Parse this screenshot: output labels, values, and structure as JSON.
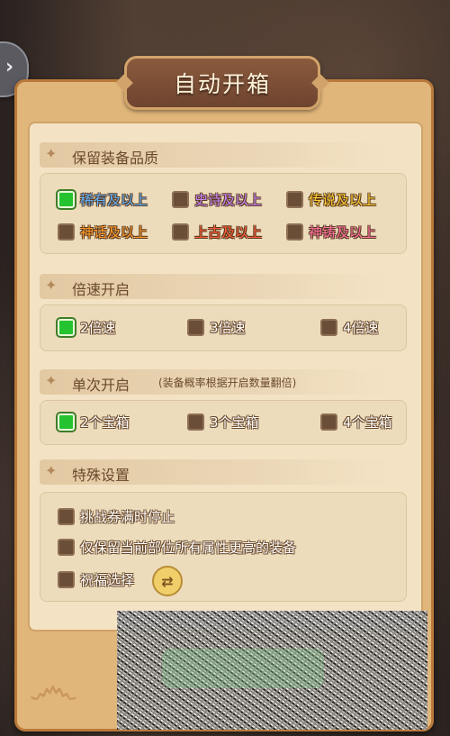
{
  "title": "自动开箱",
  "colors": {
    "checked": "#25c32f",
    "unchecked": "#6a4e38"
  },
  "sections": {
    "quality": {
      "label": "保留装备品质",
      "options": [
        {
          "label": "稀有及以上",
          "checked": true,
          "color": "#5fb3ff"
        },
        {
          "label": "史诗及以上",
          "checked": false,
          "color": "#c684ff"
        },
        {
          "label": "传说及以上",
          "checked": false,
          "color": "#ffcf34"
        },
        {
          "label": "神话及以上",
          "checked": false,
          "color": "#ff9a2e"
        },
        {
          "label": "上古及以上",
          "checked": false,
          "color": "#ff5a3a"
        },
        {
          "label": "神铸及以上",
          "checked": false,
          "color": "#ff6fa6"
        }
      ]
    },
    "speed": {
      "label": "倍速开启",
      "options": [
        {
          "label": "2倍速",
          "checked": true
        },
        {
          "label": "3倍速",
          "checked": false
        },
        {
          "label": "4倍速",
          "checked": false
        }
      ]
    },
    "single": {
      "label": "单次开启",
      "note": "(装备概率根据开启数量翻倍)",
      "options": [
        {
          "label": "2个宝箱",
          "checked": true
        },
        {
          "label": "3个宝箱",
          "checked": false
        },
        {
          "label": "4个宝箱",
          "checked": false
        }
      ]
    },
    "special": {
      "label": "特殊设置",
      "options": [
        {
          "label": "挑战券满时停止",
          "checked": false
        },
        {
          "label": "仅保留当前部位所有属性更高的装备",
          "checked": false
        },
        {
          "label": "祝福选择",
          "checked": false
        }
      ]
    }
  },
  "icons": {
    "side_handle": "chevron-right-icon",
    "swap": "swap-icon",
    "flourish": "flourish-icon",
    "spiral": "spiral-ornament-icon"
  }
}
